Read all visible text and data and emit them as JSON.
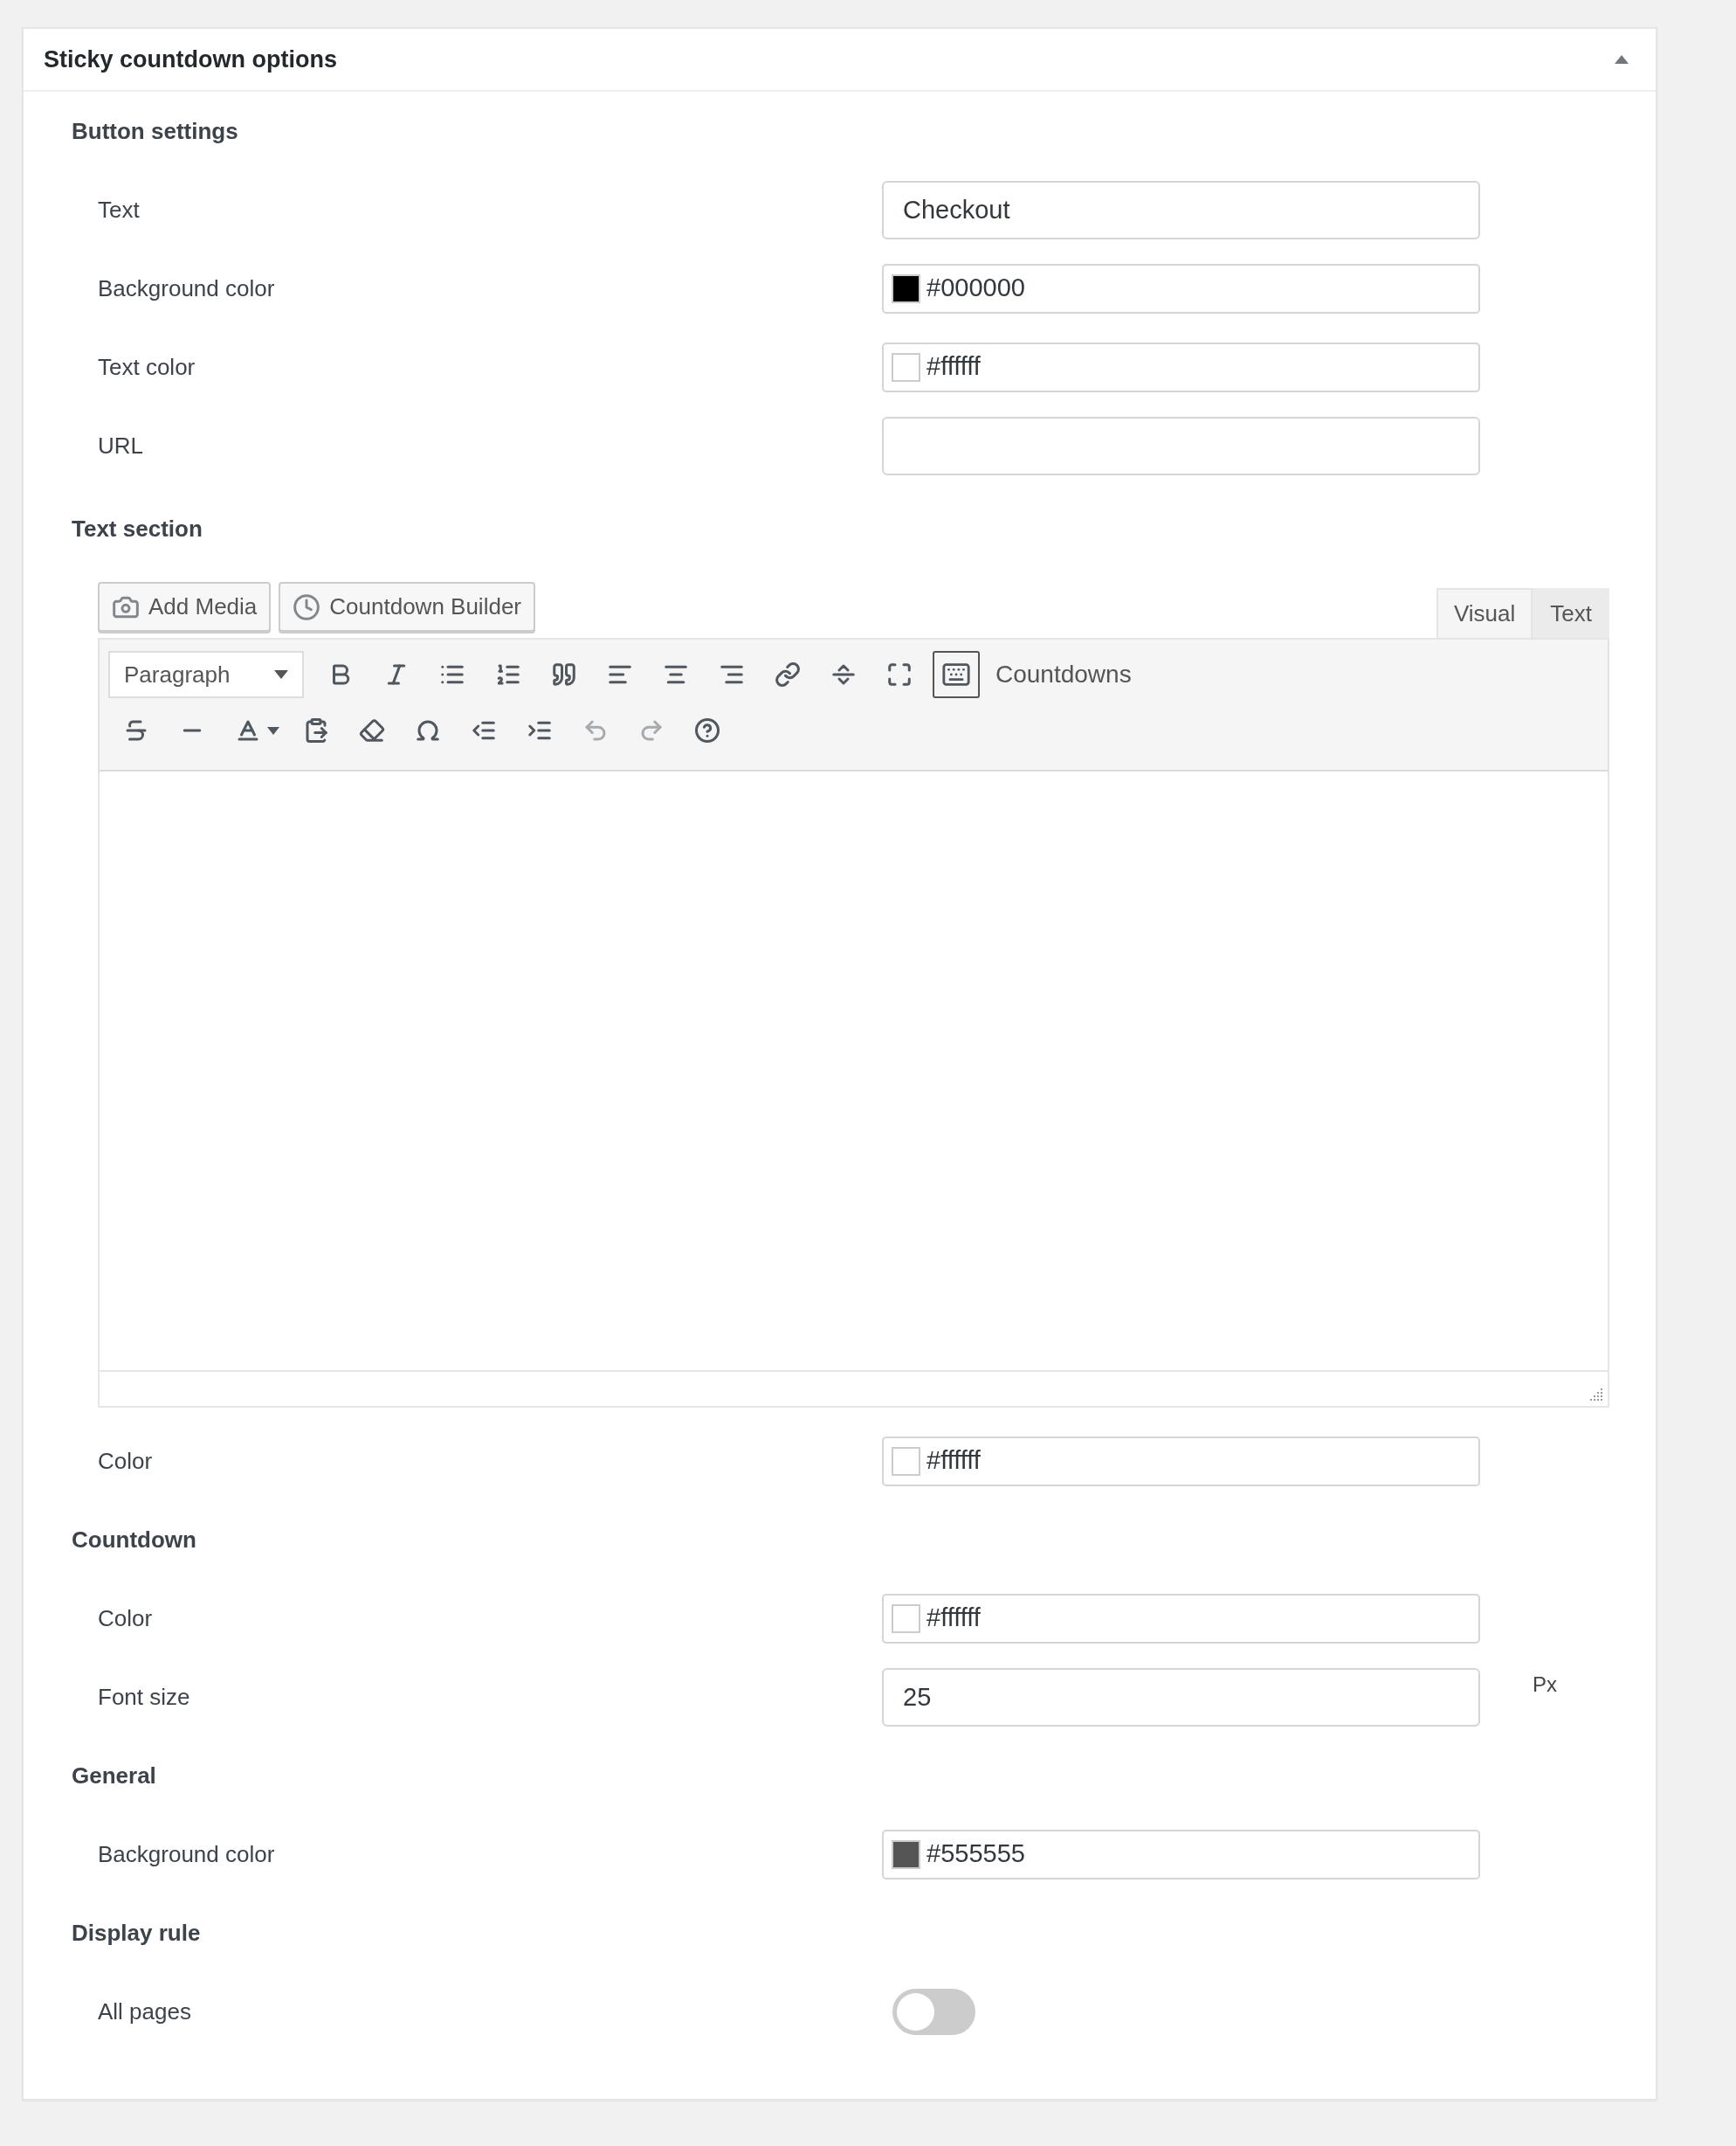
{
  "panel": {
    "title": "Sticky countdown options",
    "expanded": true
  },
  "sections": [
    {
      "heading": "Button settings",
      "fields": [
        {
          "kind": "text",
          "label": "Text",
          "value": "Checkout"
        },
        {
          "kind": "color",
          "label": "Background color",
          "value": "#000000",
          "color": "#000000"
        },
        {
          "kind": "color",
          "label": "Text color",
          "value": "#ffffff",
          "color": "#ffffff"
        },
        {
          "kind": "text",
          "label": "URL"
        }
      ]
    },
    {
      "heading": "Text section",
      "editor": {
        "media_buttons": [
          "Add Media",
          "Countdown Builder"
        ],
        "tabs": [
          {
            "label": "Visual",
            "selected": true
          },
          {
            "label": "Text",
            "selected": false
          }
        ],
        "format": "Paragraph",
        "plugin_button": "Countdowns"
      },
      "fields": [
        {
          "kind": "color",
          "label": "Color",
          "value": "#ffffff",
          "color": "#ffffff"
        }
      ]
    },
    {
      "heading": "Countdown",
      "fields": [
        {
          "kind": "color",
          "label": "Color",
          "value": "#ffffff",
          "color": "#ffffff"
        },
        {
          "kind": "text",
          "label": "Font size",
          "value": "25",
          "suffix": "Px"
        }
      ]
    },
    {
      "heading": "General",
      "fields": [
        {
          "kind": "color",
          "label": "Background color",
          "value": "#555555",
          "color": "#555555"
        }
      ]
    },
    {
      "heading": "Display rule",
      "fields": [
        {
          "kind": "toggle",
          "label": "All pages",
          "on": false
        }
      ]
    }
  ]
}
